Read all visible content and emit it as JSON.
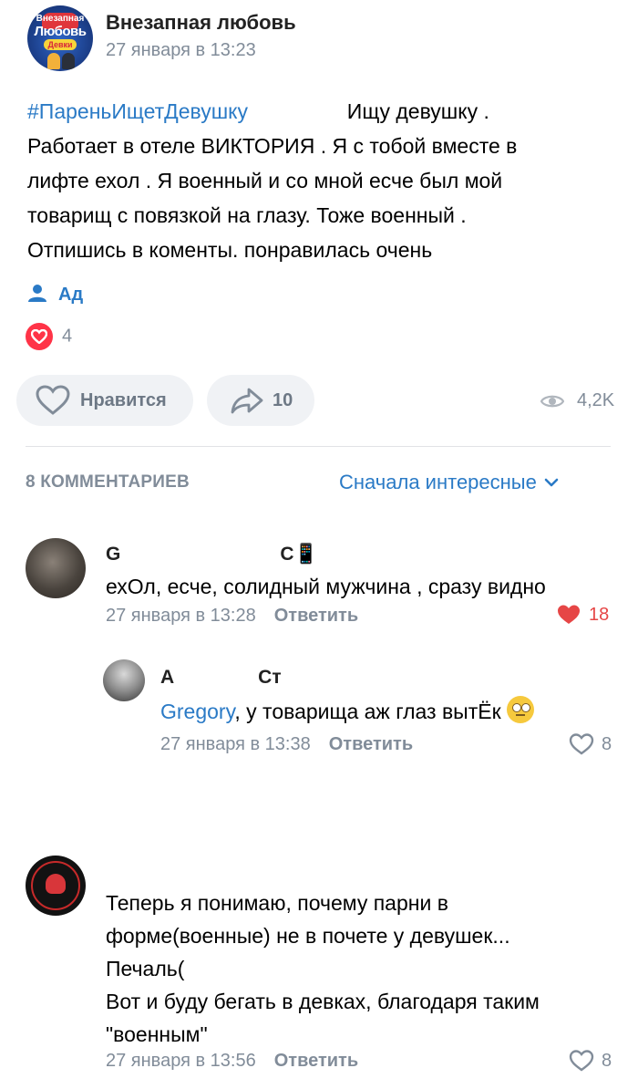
{
  "post": {
    "group_name": "Внезапная любовь",
    "date": "27 января в 13:23",
    "avatar_text": [
      "Внезапная",
      "Любовь",
      "Девки"
    ],
    "hashtag": "#ПареньИщетДевушку",
    "text_line1_rest": "Ищу девушку .",
    "text_lines": [
      "Работает в отеле ВИКТОРИЯ . Я с тобой вместе в",
      "лифте ехол . Я военный и со мной есче был мой",
      "товарищ с повязкой на глазу. Тоже военный .",
      "Отпишись в коменты. понравилась очень"
    ],
    "author": "Ад",
    "reactions_count": "4",
    "like_label": "Нравится",
    "shares_count": "10",
    "views": "4,2K"
  },
  "comments_section": {
    "count_label": "8 КОММЕНТАРИЕВ",
    "sort_label": "Сначала интересные"
  },
  "comments": [
    {
      "name": "G",
      "name_tail": "С📱",
      "text": "ехОл, есче, солидный мужчина , сразу видно",
      "date": "27 января в 13:28",
      "reply_label": "Ответить",
      "likes": "18",
      "liked": true
    },
    {
      "name": "А",
      "name_tail": "Ст",
      "mention": "Gregory",
      "text": ", у товарища аж глаз вытЁк",
      "date": "27 января в 13:38",
      "reply_label": "Ответить",
      "likes": "8"
    },
    {
      "name": "",
      "text_lines": [
        "Теперь я понимаю, почему парни в",
        "форме(военные) не в почете у девушек...",
        "Печаль(",
        "Вот и буду бегать в девках, благодаря таким",
        "\"военным\""
      ],
      "date": "27 января в 13:56",
      "reply_label": "Ответить",
      "likes": "8"
    }
  ],
  "colors": {
    "accent": "#2a7ac6",
    "secondary": "#818c99",
    "like_red": "#e64646"
  }
}
